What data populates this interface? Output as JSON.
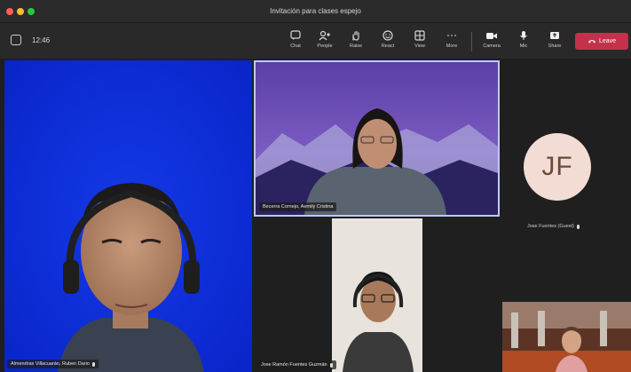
{
  "window": {
    "title": "Invitación para clases espejo"
  },
  "toolbar": {
    "timer": "12:46",
    "buttons": [
      {
        "label": "Chat",
        "icon": "chat-icon"
      },
      {
        "label": "People",
        "icon": "people-icon"
      },
      {
        "label": "Raise",
        "icon": "raise-hand-icon"
      },
      {
        "label": "React",
        "icon": "react-icon"
      },
      {
        "label": "View",
        "icon": "view-icon"
      },
      {
        "label": "More",
        "icon": "more-icon"
      },
      {
        "label": "Camera",
        "icon": "camera-icon"
      },
      {
        "label": "Mic",
        "icon": "mic-icon"
      },
      {
        "label": "Share",
        "icon": "share-icon"
      }
    ],
    "leave_label": "Leave"
  },
  "participants": {
    "p1": {
      "name": "Almendras Villacuarán, Ruben Dario"
    },
    "p2": {
      "name": "Becerra Cornejo, Aemily Cristina"
    },
    "p3": {
      "name": "Jose Fuentes (Guest)",
      "initials": "JF"
    },
    "p4": {
      "name": "Jose Ramón Fuentes Guzmán"
    }
  },
  "colors": {
    "leave": "#c4314b",
    "blue_bg": "#0a2bd6",
    "avatar_bg": "#f2dcd3"
  }
}
